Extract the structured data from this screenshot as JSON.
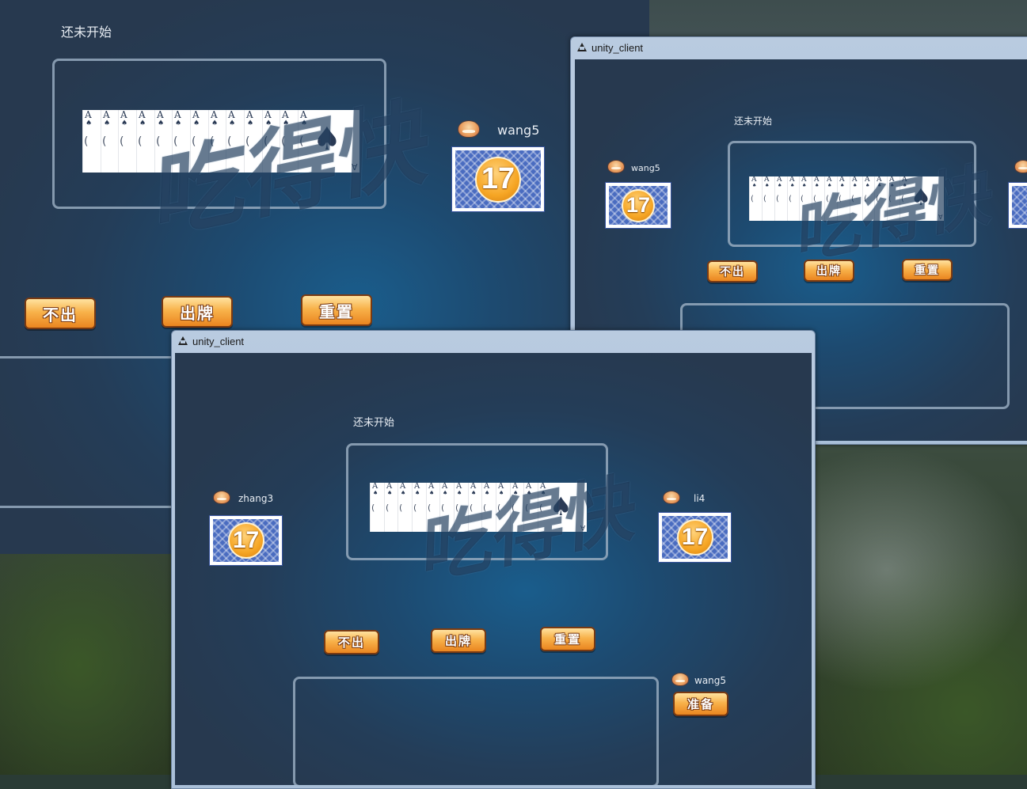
{
  "colors": {
    "accent_button": "#f8b24a",
    "card_back": "#4a6cc0",
    "count_badge": "#f6a625",
    "panel_border": "#96aabe",
    "window_title_bar": "#b9cbe0"
  },
  "watermark": "吃得快",
  "back_window": {
    "status": "还未开始",
    "hand": {
      "rank": "A",
      "suit": "♠",
      "count": 13
    },
    "player": {
      "name": "wang5",
      "card_count": "17"
    },
    "buttons": {
      "pass": "不出",
      "play": "出牌",
      "reset": "重置"
    }
  },
  "right_window": {
    "title": "unity_client",
    "status": "还未开始",
    "hand": {
      "rank": "A",
      "suit": "♠",
      "count": 13
    },
    "left_player": {
      "name": "wang5",
      "card_count": "17"
    },
    "buttons": {
      "pass": "不出",
      "play": "出牌",
      "reset": "重置"
    }
  },
  "front_window": {
    "title": "unity_client",
    "status": "还未开始",
    "hand": {
      "rank": "A",
      "suit": "♠",
      "count": 13
    },
    "left_player": {
      "name": "zhang3",
      "card_count": "17"
    },
    "right_player": {
      "name": "li4",
      "card_count": "17"
    },
    "buttons": {
      "pass": "不出",
      "play": "出牌",
      "reset": "重置"
    },
    "self_player": {
      "name": "wang5",
      "ready_label": "准备"
    }
  },
  "icons": {
    "window_icon": "unity-icon",
    "avatar": "avatar-icon",
    "card_back": "card-back-icon"
  }
}
